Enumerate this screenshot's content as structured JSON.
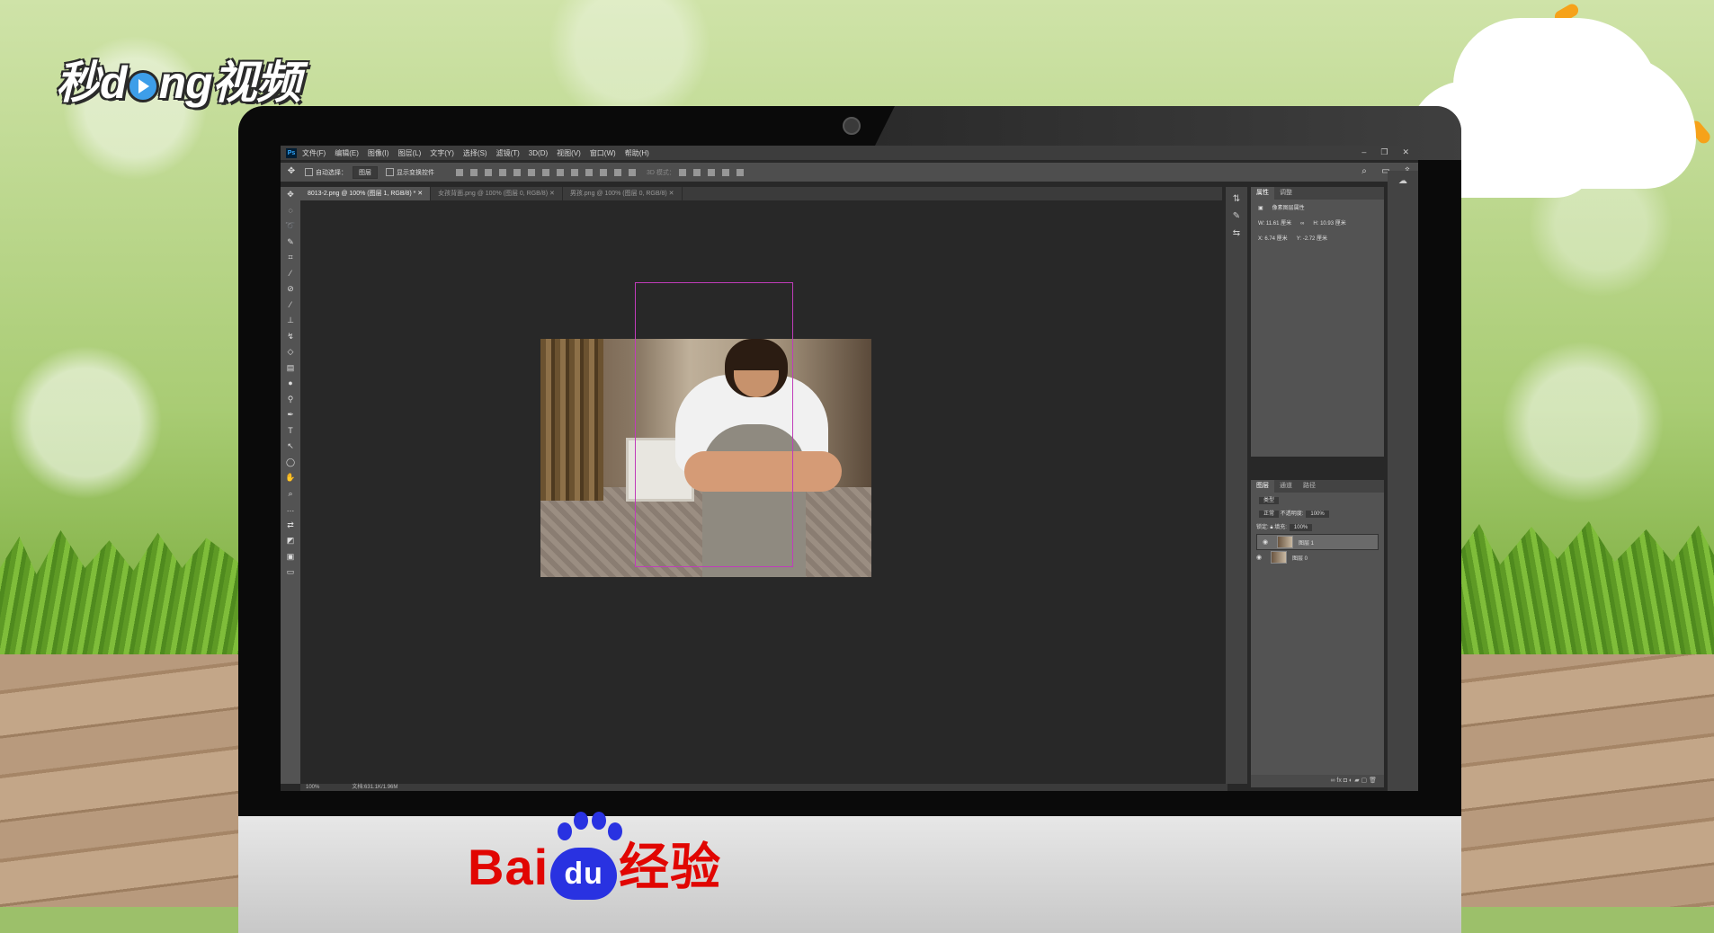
{
  "brand": {
    "top_logo_pre": "秒",
    "top_logo_mid": "d",
    "top_logo_post": "ng视频",
    "bottom_logo_left": "Bai",
    "bottom_logo_paw": "du",
    "bottom_logo_right": "经验"
  },
  "menubar": {
    "app_icon": "Ps",
    "items": [
      "文件(F)",
      "编辑(E)",
      "图像(I)",
      "图层(L)",
      "文字(Y)",
      "选择(S)",
      "滤镜(T)",
      "3D(D)",
      "视图(V)",
      "窗口(W)",
      "帮助(H)"
    ]
  },
  "options": {
    "auto_select_label": "自动选择：",
    "layer_select": "图层",
    "show_transform_label": "显示变换控件",
    "mode_3d": "3D 模式："
  },
  "document_tabs": [
    "8013-2.png @ 100% (图层 1, RGB/8) *",
    "女孩背面.png @ 100% (图层 0, RGB/8)",
    "男孩.png @ 100% (图层 0, RGB/8)"
  ],
  "status": {
    "zoom": "100%",
    "doc": "文档:631.1K/1.96M"
  },
  "properties": {
    "tabs": [
      "属性",
      "调整"
    ],
    "title": "像素图层属性",
    "w": "W: 11.61 厘米",
    "h": "H: 10.93 厘米",
    "x": "X: 6.74 厘米",
    "y": "Y: -2.72 厘米"
  },
  "layers": {
    "tabs": [
      "图层",
      "通道",
      "路径"
    ],
    "filter": "类型",
    "blend": "正常",
    "opacity_label": "不透明度:",
    "opacity": "100%",
    "lock_label": "锁定:",
    "fill_label": "填充:",
    "fill": "100%",
    "rows": [
      {
        "name": "图层 1",
        "selected": true
      },
      {
        "name": "图层 0",
        "selected": false
      }
    ]
  }
}
